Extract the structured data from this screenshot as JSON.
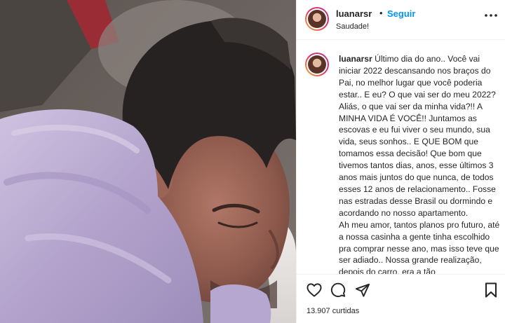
{
  "post": {
    "username": "luanarsr",
    "separator": "•",
    "follow_label": "Seguir",
    "location": "Saudade!",
    "more_icon": "ellipsis-icon"
  },
  "caption": {
    "username": "luanarsr",
    "text": "Último dia do ano.. Você vai iniciar 2022 descansando nos braços do Pai, no melhor lugar que você poderia estar.. E eu? O que vai ser do meu 2022? Aliás, o que vai ser da minha vida?!! A MINHA VIDA É VOCÊ!! Juntamos as escovas e eu fui viver o seu mundo, sua vida, seus sonhos.. E QUE BOM que tomamos essa decisão! Que bom que tivemos tantos dias, anos, esse últimos 3 anos mais juntos do que nunca, de todos esses 12 anos de relacionamento.. Fosse nas estradas desse Brasil ou dormindo e acordando no nosso apartamento.\nAh meu amor, tantos planos pro futuro, até a nossa casinha a gente tinha escolhido pra comprar nesse ano, mas isso teve que ser adiado.. Nossa grande realização, depois do carro, era a tão"
  },
  "actions": {
    "like_icon": "heart-icon",
    "comment_icon": "comment-icon",
    "share_icon": "share-icon",
    "save_icon": "bookmark-icon"
  },
  "likes_text": "13.907 curtidas",
  "colors": {
    "follow": "#0095f6",
    "text": "#262626",
    "divider": "#efefef",
    "blanket": "#b9a9cf"
  }
}
